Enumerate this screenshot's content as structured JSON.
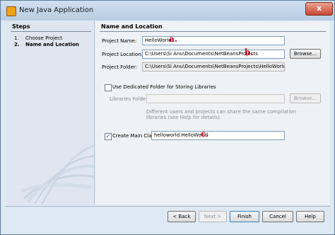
{
  "window": {
    "title": "New Java Application",
    "close_label": "x"
  },
  "steps": {
    "title": "Steps",
    "items": [
      {
        "num": "1.",
        "label": "Choose Project"
      },
      {
        "num": "2.",
        "label": "Name and Location"
      }
    ]
  },
  "panel": {
    "title": "Name and Location",
    "project_name_label": "Project Name:",
    "project_name_value": "HelloWorld",
    "project_location_label": "Project Location:",
    "project_location_value": "C:\\Users\\Si Anu\\Documents\\NetBeansProjects",
    "browse_label": "Browse...",
    "project_folder_label": "Project Folder:",
    "project_folder_value": "C:\\Users\\Si Anu\\Documents\\NetBeansProjects\\HelloWorld",
    "dedicated_folder_label": "Use Dedicated Folder for Storing Libraries",
    "dedicated_folder_checked": false,
    "libraries_folder_label": "Libraries Folder:",
    "libraries_browse_label": "Browse...",
    "shared_note_line1": "Different users and projects can share the same compilation",
    "shared_note_line2": "libraries (see Help for details).",
    "create_main_label": "Create Main Class",
    "create_main_checked": true,
    "main_class_value": "helloworld.HelloWorld"
  },
  "annotations": {
    "a": "a.",
    "b": "b.",
    "c": "c."
  },
  "footer": {
    "back": "< Back",
    "next": "Next >",
    "finish": "Finish",
    "cancel": "Cancel",
    "help": "Help"
  }
}
